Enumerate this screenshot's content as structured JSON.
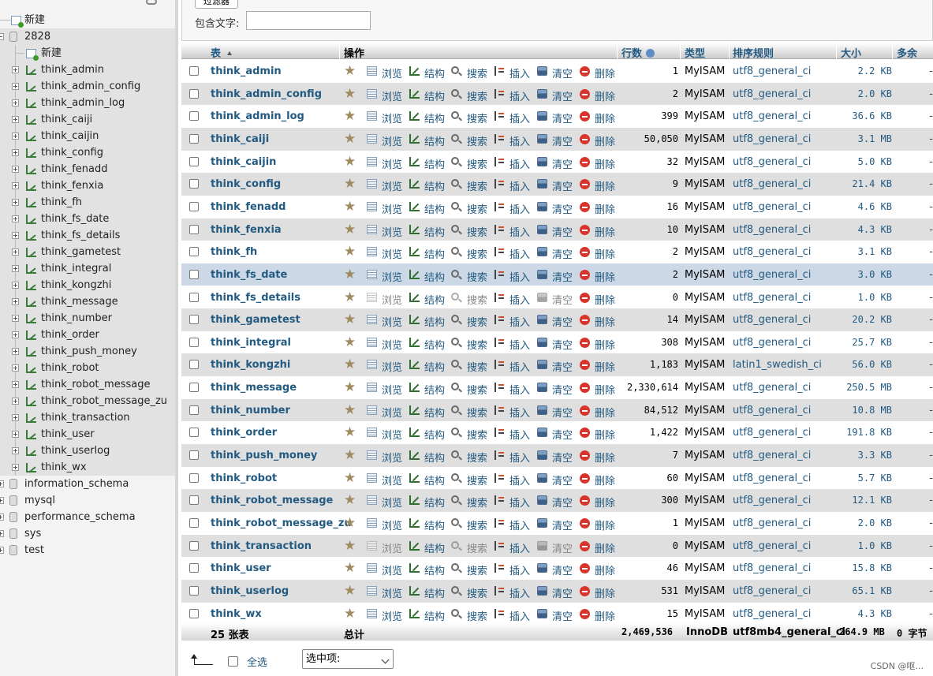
{
  "nav": {
    "top_new_label": "新建",
    "current_db": "2828",
    "db_new_label": "新建",
    "tables": [
      "think_admin",
      "think_admin_config",
      "think_admin_log",
      "think_caiji",
      "think_caijin",
      "think_config",
      "think_fenadd",
      "think_fenxia",
      "think_fh",
      "think_fs_date",
      "think_fs_details",
      "think_gametest",
      "think_integral",
      "think_kongzhi",
      "think_message",
      "think_number",
      "think_order",
      "think_push_money",
      "think_robot",
      "think_robot_message",
      "think_robot_message_zu",
      "think_transaction",
      "think_user",
      "think_userlog",
      "think_wx"
    ],
    "other_dbs": [
      "information_schema",
      "mysql",
      "performance_schema",
      "sys",
      "test"
    ]
  },
  "filter": {
    "legend": "过滤器",
    "contains_label": "包含文字:",
    "contains_value": ""
  },
  "table_header": {
    "table": "表",
    "action": "操作",
    "rows": "行数",
    "type": "类型",
    "collation": "排序规则",
    "size": "大小",
    "overhead": "多余"
  },
  "actions": {
    "browse": "浏览",
    "structure": "结构",
    "search": "搜索",
    "insert": "插入",
    "empty": "清空",
    "drop": "删除"
  },
  "rows": [
    {
      "name": "think_admin",
      "rows": "1",
      "engine": "MyISAM",
      "collation": "utf8_general_ci",
      "size": "2.2 KB",
      "overhead": "-"
    },
    {
      "name": "think_admin_config",
      "rows": "2",
      "engine": "MyISAM",
      "collation": "utf8_general_ci",
      "size": "2.0 KB",
      "overhead": "-"
    },
    {
      "name": "think_admin_log",
      "rows": "399",
      "engine": "MyISAM",
      "collation": "utf8_general_ci",
      "size": "36.6 KB",
      "overhead": "-"
    },
    {
      "name": "think_caiji",
      "rows": "50,050",
      "engine": "MyISAM",
      "collation": "utf8_general_ci",
      "size": "3.1 MB",
      "overhead": "-"
    },
    {
      "name": "think_caijin",
      "rows": "32",
      "engine": "MyISAM",
      "collation": "utf8_general_ci",
      "size": "5.0 KB",
      "overhead": "-"
    },
    {
      "name": "think_config",
      "rows": "9",
      "engine": "MyISAM",
      "collation": "utf8_general_ci",
      "size": "21.4 KB",
      "overhead": "-"
    },
    {
      "name": "think_fenadd",
      "rows": "16",
      "engine": "MyISAM",
      "collation": "utf8_general_ci",
      "size": "4.6 KB",
      "overhead": "-"
    },
    {
      "name": "think_fenxia",
      "rows": "10",
      "engine": "MyISAM",
      "collation": "utf8_general_ci",
      "size": "4.3 KB",
      "overhead": "-"
    },
    {
      "name": "think_fh",
      "rows": "2",
      "engine": "MyISAM",
      "collation": "utf8_general_ci",
      "size": "3.1 KB",
      "overhead": "-"
    },
    {
      "name": "think_fs_date",
      "rows": "2",
      "engine": "MyISAM",
      "collation": "utf8_general_ci",
      "size": "3.0 KB",
      "overhead": "-",
      "highlight": true
    },
    {
      "name": "think_fs_details",
      "rows": "0",
      "engine": "MyISAM",
      "collation": "utf8_general_ci",
      "size": "1.0 KB",
      "overhead": "-",
      "empty": true
    },
    {
      "name": "think_gametest",
      "rows": "14",
      "engine": "MyISAM",
      "collation": "utf8_general_ci",
      "size": "20.2 KB",
      "overhead": "-"
    },
    {
      "name": "think_integral",
      "rows": "308",
      "engine": "MyISAM",
      "collation": "utf8_general_ci",
      "size": "25.7 KB",
      "overhead": "-"
    },
    {
      "name": "think_kongzhi",
      "rows": "1,183",
      "engine": "MyISAM",
      "collation": "latin1_swedish_ci",
      "size": "56.0 KB",
      "overhead": "-"
    },
    {
      "name": "think_message",
      "rows": "2,330,614",
      "engine": "MyISAM",
      "collation": "utf8_general_ci",
      "size": "250.5 MB",
      "overhead": "-"
    },
    {
      "name": "think_number",
      "rows": "84,512",
      "engine": "MyISAM",
      "collation": "utf8_general_ci",
      "size": "10.8 MB",
      "overhead": "-"
    },
    {
      "name": "think_order",
      "rows": "1,422",
      "engine": "MyISAM",
      "collation": "utf8_general_ci",
      "size": "191.8 KB",
      "overhead": "-"
    },
    {
      "name": "think_push_money",
      "rows": "7",
      "engine": "MyISAM",
      "collation": "utf8_general_ci",
      "size": "3.3 KB",
      "overhead": "-"
    },
    {
      "name": "think_robot",
      "rows": "60",
      "engine": "MyISAM",
      "collation": "utf8_general_ci",
      "size": "5.7 KB",
      "overhead": "-"
    },
    {
      "name": "think_robot_message",
      "rows": "300",
      "engine": "MyISAM",
      "collation": "utf8_general_ci",
      "size": "12.1 KB",
      "overhead": "-"
    },
    {
      "name": "think_robot_message_zu",
      "rows": "1",
      "engine": "MyISAM",
      "collation": "utf8_general_ci",
      "size": "2.0 KB",
      "overhead": "-"
    },
    {
      "name": "think_transaction",
      "rows": "0",
      "engine": "MyISAM",
      "collation": "utf8_general_ci",
      "size": "1.0 KB",
      "overhead": "-",
      "empty": true
    },
    {
      "name": "think_user",
      "rows": "46",
      "engine": "MyISAM",
      "collation": "utf8_general_ci",
      "size": "15.8 KB",
      "overhead": "-"
    },
    {
      "name": "think_userlog",
      "rows": "531",
      "engine": "MyISAM",
      "collation": "utf8_general_ci",
      "size": "65.1 KB",
      "overhead": "-"
    },
    {
      "name": "think_wx",
      "rows": "15",
      "engine": "MyISAM",
      "collation": "utf8_general_ci",
      "size": "4.3 KB",
      "overhead": "-"
    }
  ],
  "footer": {
    "table_count": "25 张表",
    "sum_label": "总计",
    "total_rows": "2,469,536",
    "engine": "InnoDB",
    "collation": "utf8mb4_general_ci",
    "total_size": "264.9 MB",
    "overhead": "0 字节"
  },
  "bottom": {
    "check_all_label": "全选",
    "with_selected": "选中项:"
  },
  "watermark": "CSDN @呕...",
  "colors": {
    "link": "#235a81",
    "row_even": "#dfdfdf",
    "row_highlight": "#ccd8e6",
    "drop_icon": "#d7352c"
  }
}
